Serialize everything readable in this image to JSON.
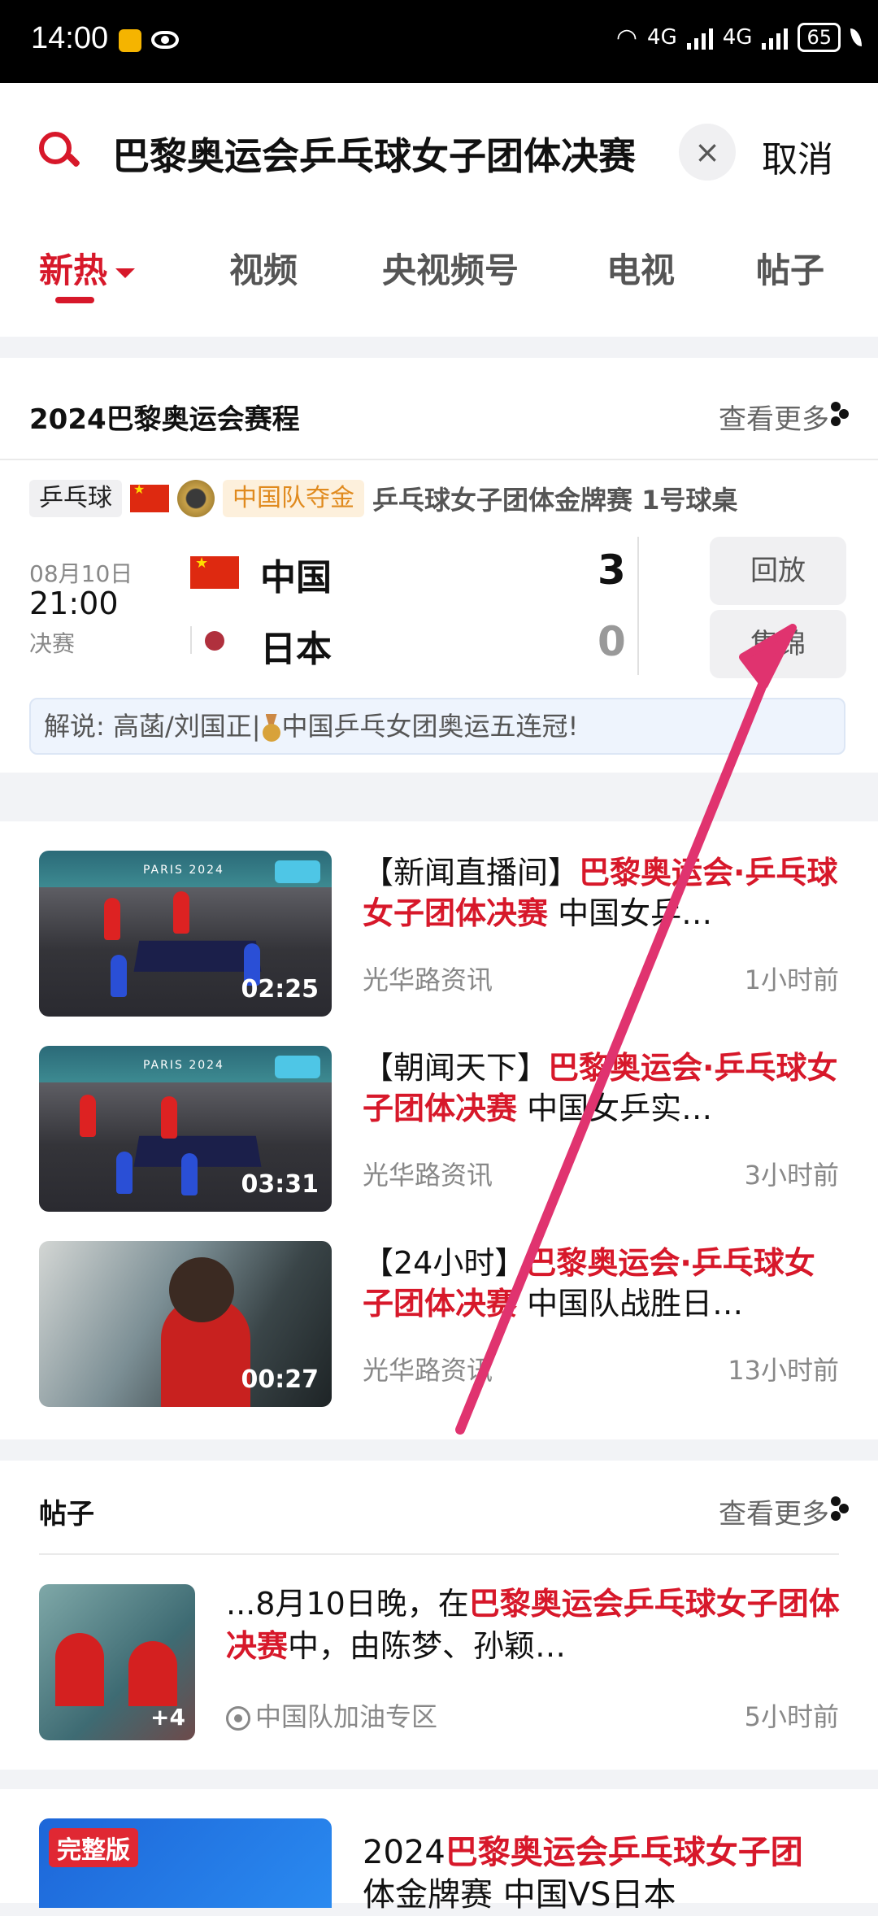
{
  "status_bar": {
    "time": "14:00",
    "network1": "4G",
    "network2": "4G",
    "battery": "65"
  },
  "search": {
    "query": "巴黎奥运会乒乓球女子团体决赛",
    "clear": "×",
    "cancel": "取消"
  },
  "tabs": [
    {
      "label": "新热",
      "active": true
    },
    {
      "label": "视频"
    },
    {
      "label": "央视频号"
    },
    {
      "label": "电视"
    },
    {
      "label": "帖子"
    }
  ],
  "schedule": {
    "title": "2024巴黎奥运会赛程",
    "more": "查看更多",
    "sport": "乒乓球",
    "badge": "中国队夺金",
    "event": "乒乓球女子团体金牌赛 1号球桌",
    "date": "08月10日",
    "time": "21:00",
    "stage": "决赛",
    "team1": "中国",
    "score1": "3",
    "team2": "日本",
    "score2": "0",
    "replay": "回放",
    "highlights": "集锦",
    "commentary_pre": "解说: 高菡/刘国正|",
    "commentary_post": "中国乒乓女团奥运五连冠!"
  },
  "videos": [
    {
      "pre": "【新闻直播间】",
      "hl": "巴黎奥运会·乒乓球女子团体决赛",
      "post": " 中国女乒…",
      "source": "光华路资讯",
      "time": "1小时前",
      "duration": "02:25"
    },
    {
      "pre": "【朝闻天下】",
      "hl": "巴黎奥运会·乒乓球女子团体决赛",
      "post": " 中国女乒实…",
      "source": "光华路资讯",
      "time": "3小时前",
      "duration": "03:31"
    },
    {
      "pre": "【24小时】",
      "hl": "巴黎奥运会·乒乓球女子团体决赛",
      "post": " 中国队战胜日…",
      "source": "光华路资讯",
      "time": "13小时前",
      "duration": "00:27"
    }
  ],
  "posts": {
    "title": "帖子",
    "more": "查看更多",
    "item": {
      "pre": "...8月10日晚，在",
      "hl": "巴黎奥运会乒乓球女子团体决赛",
      "post": "中，由陈梦、孙颖…",
      "source": "中国队加油专区",
      "time": "5小时前",
      "image_count": "+4"
    }
  },
  "bottom": {
    "badge": "完整版",
    "pre": "2024",
    "hl": "巴黎奥运会乒乓球女子团",
    "post": "体金牌赛 中国VS日本"
  },
  "colors": {
    "accent": "#d7182a",
    "arrow": "#e0336f"
  }
}
